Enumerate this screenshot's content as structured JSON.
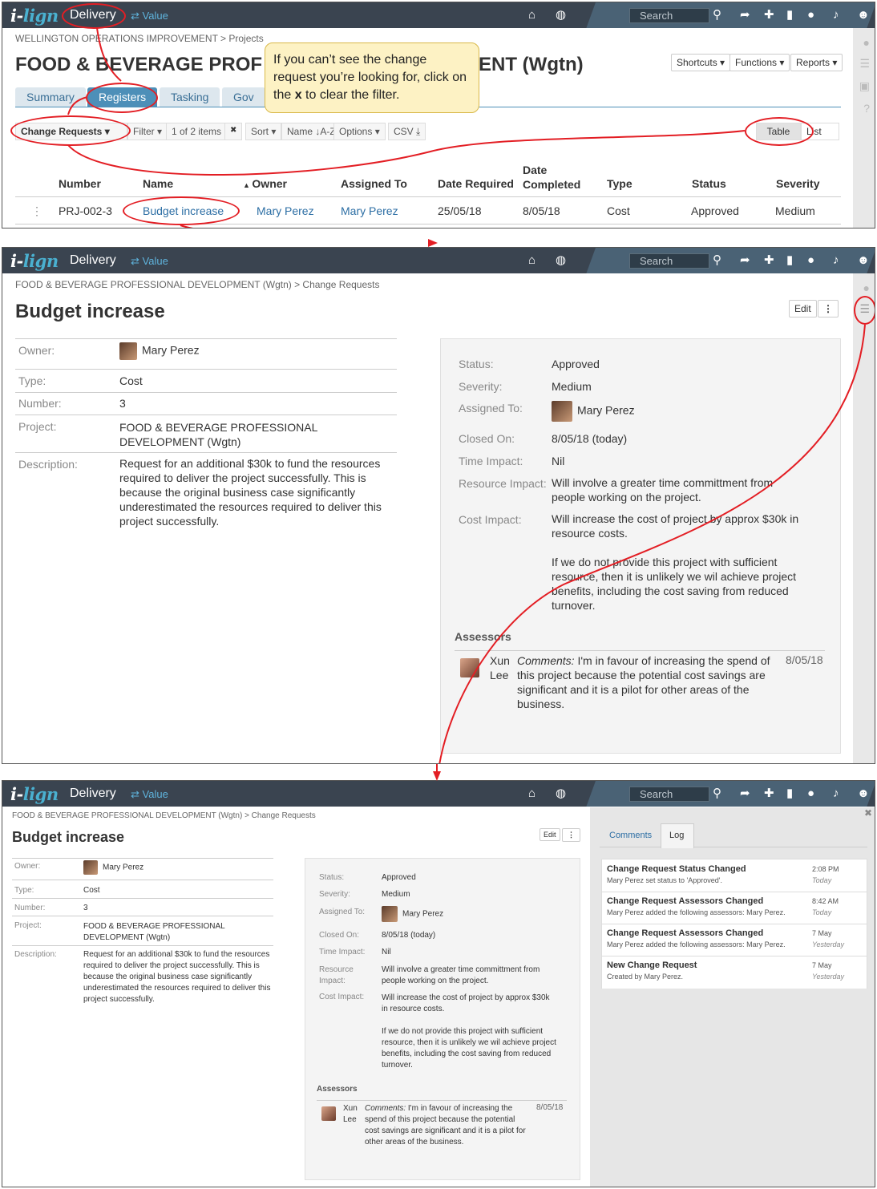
{
  "app": {
    "logo_prefix": "i-",
    "logo_suffix": "lign",
    "module": "Delivery",
    "switch_label": "Value",
    "search_placeholder": "Search"
  },
  "panel1": {
    "breadcrumb": "WELLINGTON OPERATIONS IMPROVEMENT > Projects",
    "title_left": "FOOD & BEVERAGE PROF",
    "title_right": "ENT (Wgtn)",
    "buttons": {
      "shortcuts": "Shortcuts ▾",
      "functions": "Functions ▾",
      "reports": "Reports ▾"
    },
    "tabs": [
      "Summary",
      "Registers",
      "Tasking",
      "Gov"
    ],
    "toolbar": {
      "register": "Change Requests ▾",
      "filter": "Filter ▾",
      "items": "1 of 2 items",
      "clear": "✖",
      "sort": "Sort ▾",
      "sort_field": "Name ↓A-Z",
      "options": "Options ▾",
      "csv": "CSV ⤓",
      "table": "Table",
      "list": "List"
    },
    "callout": {
      "before": "If you can’t see the change request you’re looking for, click on the ",
      "key": "x",
      "after": " to clear the filter."
    },
    "columns": {
      "number": "Number",
      "name": "Name",
      "owner": "Owner",
      "assigned": "Assigned To",
      "required": "Date Required",
      "completed_1": "Date",
      "completed_2": "Completed",
      "type": "Type",
      "status": "Status",
      "severity": "Severity"
    },
    "row": {
      "number": "PRJ-002-3",
      "name": "Budget increase",
      "owner": "Mary Perez",
      "assigned": "Mary Perez",
      "required": "25/05/18",
      "completed": "8/05/18",
      "type": "Cost",
      "status": "Approved",
      "severity": "Medium"
    }
  },
  "detail": {
    "breadcrumb": "FOOD & BEVERAGE PROFESSIONAL DEVELOPMENT (Wgtn) > Change Requests",
    "title": "Budget increase",
    "edit": "Edit",
    "more": "⋮",
    "labels": {
      "owner": "Owner:",
      "type": "Type:",
      "number": "Number:",
      "project": "Project:",
      "description": "Description:",
      "status": "Status:",
      "severity": "Severity:",
      "assigned": "Assigned To:",
      "closed": "Closed On:",
      "time": "Time Impact:",
      "resource": "Resource Impact:",
      "cost": "Cost Impact:",
      "assessors": "Assessors"
    },
    "owner": "Mary Perez",
    "type": "Cost",
    "number": "3",
    "project": "FOOD & BEVERAGE PROFESSIONAL DEVELOPMENT (Wgtn)",
    "description": "Request for an additional $30k to fund the resources required to deliver the project successfully. This is because the original business case significantly underestimated the resources required to deliver this project successfully.",
    "status": "Approved",
    "severity": "Medium",
    "assigned": "Mary Perez",
    "closed": "8/05/18 (today)",
    "time_impact": "Nil",
    "resource_impact": "Will involve a greater time committment from people working on the project.",
    "cost_impact_1": "Will increase the cost of project by approx $30k in resource costs.",
    "cost_impact_2": "If we do not provide this project with sufficient resource, then it is unlikely we wil achieve project benefits, including the cost saving from reduced turnover.",
    "assessor_name": "Xun Lee",
    "assessor_comment_label": "Comments:",
    "assessor_comment": "I'm in favour of increasing the spend of this project because the potential cost savings are significant and it is a pilot for other areas of the business.",
    "assessor_date": "8/05/18"
  },
  "panel3": {
    "tabs": [
      "Comments",
      "Log"
    ],
    "close": "✖",
    "log": [
      {
        "title": "Change Request Status Changed",
        "sub": "Mary Perez set status to 'Approved'.",
        "time": "2:08 PM",
        "day": "Today"
      },
      {
        "title": "Change Request Assessors Changed",
        "sub": "Mary Perez added the following assessors: Mary Perez.",
        "time": "8:42 AM",
        "day": "Today"
      },
      {
        "title": "Change Request Assessors Changed",
        "sub": "Mary Perez added the following assessors: Mary Perez.",
        "time": "7 May",
        "day": "Yesterday"
      },
      {
        "title": "New Change Request",
        "sub": "Created by Mary Perez.",
        "time": "7 May",
        "day": "Yesterday"
      }
    ]
  }
}
